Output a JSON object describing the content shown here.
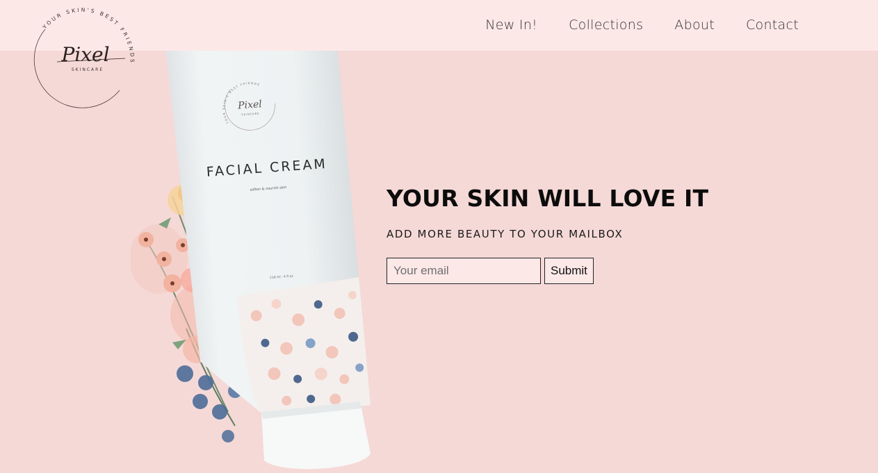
{
  "brand": {
    "logo_name": "Pixel",
    "logo_tag": "SKINCARE",
    "logo_ring": "YOUR SKIN'S BEST FRIENDS"
  },
  "nav": {
    "items": [
      {
        "label": "New In!"
      },
      {
        "label": "Collections"
      },
      {
        "label": "About"
      },
      {
        "label": "Contact"
      }
    ]
  },
  "product": {
    "name": "FACIAL CREAM",
    "tagline": "soften & nourish skin",
    "volume": "118 ml · 4 fl oz",
    "mini_logo": "Pixel",
    "mini_tag": "SKINCARE",
    "mini_ring": "YOUR SKIN'S BEST FRIENDS"
  },
  "hero": {
    "title": "YOUR SKIN WILL LOVE IT",
    "subtitle": "ADD MORE BEAUTY TO YOUR MAILBOX",
    "email_placeholder": "Your email",
    "email_value": "",
    "submit_label": "Submit"
  },
  "colors": {
    "page_bg": "#f5d9d7",
    "header_bg": "#fde8e8",
    "input_bg": "#fde8e8",
    "text": "#111111"
  }
}
